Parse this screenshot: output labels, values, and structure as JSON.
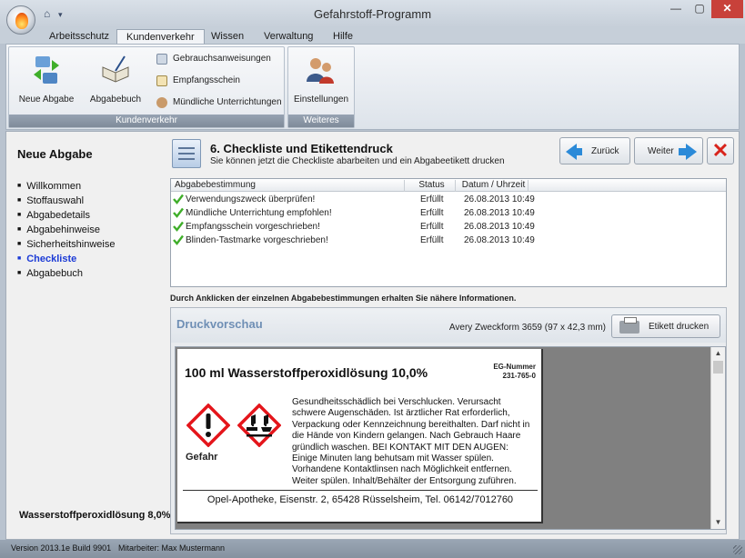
{
  "window": {
    "title": "Gefahrstoff-Programm",
    "minimize": "—",
    "restore": "▢",
    "close": "✕",
    "quick_access": [
      "⌂",
      "▾"
    ]
  },
  "ribbon": {
    "tabs": [
      "Arbeitsschutz",
      "Kundenverkehr",
      "Wissen",
      "Verwaltung",
      "Hilfe"
    ],
    "active_tab": "Kundenverkehr",
    "groups": {
      "kundenverkehr": {
        "label": "Kundenverkehr",
        "neue_abgabe": "Neue Abgabe",
        "abgabebuch": "Abgabebuch",
        "gebrauchsanweisungen": "Gebrauchsanweisungen",
        "empfangsschein": "Empfangsschein",
        "muendliche": "Mündliche Unterrichtungen"
      },
      "weiteres": {
        "label": "Weiteres",
        "einstellungen": "Einstellungen"
      }
    }
  },
  "sidebar": {
    "title": "Neue Abgabe",
    "items": [
      "Willkommen",
      "Stoffauswahl",
      "Abgabedetails",
      "Abgabehinweise",
      "Sicherheitshinweise",
      "Checkliste",
      "Abgabebuch"
    ],
    "current": "Checkliste",
    "footer": "Wasserstoffperoxidlösung 8,0%"
  },
  "step": {
    "title": "6. Checkliste und Etikettendruck",
    "subtitle": "Sie können jetzt die Checkliste abarbeiten und ein Abgabeetikett drucken",
    "back_label": "Zurück",
    "next_label": "Weiter"
  },
  "checklist": {
    "columns": [
      "Abgabebestimmung",
      "Status",
      "Datum / Uhrzeit"
    ],
    "rows": [
      {
        "rule": "Verwendungszweck überprüfen!",
        "status": "Erfüllt",
        "datetime": "26.08.2013 10:49"
      },
      {
        "rule": "Mündliche Unterrichtung empfohlen!",
        "status": "Erfüllt",
        "datetime": "26.08.2013 10:49"
      },
      {
        "rule": "Empfangsschein vorgeschrieben!",
        "status": "Erfüllt",
        "datetime": "26.08.2013 10:49"
      },
      {
        "rule": "Blinden-Tastmarke vorgeschrieben!",
        "status": "Erfüllt",
        "datetime": "26.08.2013 10:49"
      }
    ],
    "hint": "Durch Anklicken der einzelnen Abgabebestimmungen erhalten Sie nähere Informationen."
  },
  "preview": {
    "title": "Druckvorschau",
    "format": "Avery Zweckform 3659 (97 x 42,3 mm)",
    "print_label": "Etikett drucken",
    "label": {
      "product": "100 ml Wasserstoffperoxidlösung 10,0%",
      "eg_title": "EG-Nummer",
      "eg_number": "231-765-0",
      "signal_word": "Gefahr",
      "hazard_lines": [
        "Gesundheitsschädlich bei Verschlucken. Verursacht",
        "schwere Augenschäden. Ist ärztlicher Rat erforderlich,",
        "Verpackung oder Kennzeichnung bereithalten. Darf nicht in",
        "die Hände von Kindern gelangen. Nach Gebrauch Haare",
        "gründlich waschen. BEI KONTAKT MIT DEN AUGEN:",
        "Einige Minuten lang behutsam mit Wasser spülen.",
        "Vorhandene Kontaktlinsen nach Möglichkeit entfernen.",
        "Weiter spülen. Inhalt/Behälter der Entsorgung zuführen."
      ],
      "address": "Opel-Apotheke, Eisenstr. 2, 65428 Rüsselsheim, Tel. 06142/7012760"
    }
  },
  "statusbar": {
    "version": "Version 2013.1e Build 9901",
    "user": "Mitarbeiter: Max Mustermann"
  },
  "icons": [
    "flame-icon",
    "home-icon",
    "arrows-icon",
    "book-icon",
    "document-icon",
    "receipt-icon",
    "people-icon",
    "settings-people-icon",
    "checklist-icon",
    "arrow-left-icon",
    "arrow-right-icon",
    "close-icon",
    "check-icon",
    "printer-icon",
    "exclamation-hazard-icon",
    "corrosion-hazard-icon"
  ],
  "colors": {
    "accent_blue": "#2b8ad8",
    "current_step": "#1c3bd6",
    "close_red": "#d8241c",
    "preview_title": "#6f8fb5",
    "hazard_red": "#e4151b",
    "check_green": "#3fae2a"
  }
}
